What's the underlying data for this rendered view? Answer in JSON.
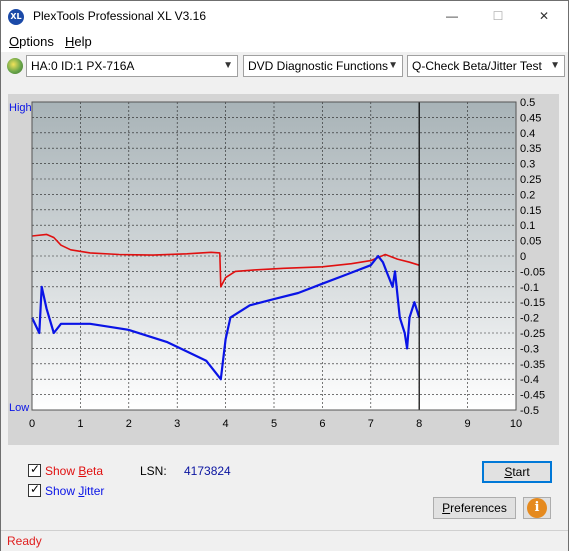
{
  "window": {
    "title": "PlexTools Professional XL V3.16",
    "app_icon_text": "XL",
    "minimize_glyph": "—",
    "maximize_glyph": "☐",
    "close_glyph": "✕"
  },
  "menu": [
    {
      "label_u": "O",
      "label_rest": "ptions"
    },
    {
      "label_u": "H",
      "label_rest": "elp"
    }
  ],
  "toolbar": {
    "drive": "HA:0 ID:1  PX-716A",
    "function": "DVD Diagnostic Functions",
    "test": "Q-Check Beta/Jitter Test",
    "dropdown_glyph": "▼"
  },
  "chart_data": {
    "type": "line",
    "x_ticks": [
      "0",
      "1",
      "2",
      "3",
      "4",
      "5",
      "6",
      "7",
      "8",
      "9",
      "10"
    ],
    "y_left_labels": {
      "top": "High",
      "bottom": "Low"
    },
    "y_right_ticks": [
      "0.5",
      "0.45",
      "0.4",
      "0.35",
      "0.3",
      "0.25",
      "0.2",
      "0.15",
      "0.1",
      "0.05",
      "0",
      "-0.05",
      "-0.1",
      "-0.15",
      "-0.2",
      "-0.25",
      "-0.3",
      "-0.35",
      "-0.4",
      "-0.45",
      "-0.5"
    ],
    "xlim": [
      0,
      10
    ],
    "ylim": [
      -0.5,
      0.5
    ],
    "grid": true,
    "end_marker_x": 8.0,
    "series": [
      {
        "color": "#e01010",
        "points": [
          [
            0,
            0.065
          ],
          [
            0.3,
            0.07
          ],
          [
            0.45,
            0.06
          ],
          [
            0.6,
            0.035
          ],
          [
            0.8,
            0.02
          ],
          [
            1.2,
            0.01
          ],
          [
            1.8,
            0.005
          ],
          [
            2.5,
            0.003
          ],
          [
            3.2,
            0.007
          ],
          [
            3.7,
            0.012
          ],
          [
            3.88,
            0.01
          ],
          [
            3.9,
            -0.1
          ],
          [
            4.0,
            -0.07
          ],
          [
            4.2,
            -0.05
          ],
          [
            4.6,
            -0.045
          ],
          [
            5.2,
            -0.04
          ],
          [
            6.0,
            -0.035
          ],
          [
            6.6,
            -0.025
          ],
          [
            7.0,
            -0.015
          ],
          [
            7.3,
            0.005
          ],
          [
            7.55,
            -0.01
          ],
          [
            7.8,
            -0.02
          ],
          [
            8.0,
            -0.03
          ]
        ]
      },
      {
        "color": "#0a14e6",
        "points": [
          [
            0,
            -0.2
          ],
          [
            0.15,
            -0.25
          ],
          [
            0.2,
            -0.1
          ],
          [
            0.3,
            -0.17
          ],
          [
            0.45,
            -0.25
          ],
          [
            0.6,
            -0.22
          ],
          [
            0.8,
            -0.22
          ],
          [
            1.2,
            -0.22
          ],
          [
            1.6,
            -0.23
          ],
          [
            2.0,
            -0.24
          ],
          [
            2.4,
            -0.26
          ],
          [
            2.8,
            -0.28
          ],
          [
            3.2,
            -0.31
          ],
          [
            3.6,
            -0.34
          ],
          [
            3.9,
            -0.4
          ],
          [
            4.0,
            -0.27
          ],
          [
            4.1,
            -0.2
          ],
          [
            4.5,
            -0.16
          ],
          [
            5.0,
            -0.14
          ],
          [
            5.5,
            -0.12
          ],
          [
            6.0,
            -0.09
          ],
          [
            6.5,
            -0.06
          ],
          [
            7.0,
            -0.03
          ],
          [
            7.15,
            0.0
          ],
          [
            7.25,
            -0.02
          ],
          [
            7.35,
            -0.06
          ],
          [
            7.45,
            -0.1
          ],
          [
            7.5,
            -0.05
          ],
          [
            7.6,
            -0.2
          ],
          [
            7.7,
            -0.25
          ],
          [
            7.75,
            -0.3
          ],
          [
            7.8,
            -0.2
          ],
          [
            7.9,
            -0.15
          ],
          [
            8.0,
            -0.2
          ]
        ]
      }
    ]
  },
  "bottom": {
    "show_beta_u": "B",
    "show_beta_pre": "Show ",
    "show_beta_post": "eta",
    "show_jitter_u": "J",
    "show_jitter_pre": "Show ",
    "show_jitter_post": "itter",
    "lsn_label": "LSN:",
    "lsn_value": "4173824",
    "start_u": "S",
    "start_rest": "tart",
    "prefs_u": "P",
    "prefs_rest": "references",
    "info_glyph": "i",
    "check_glyph": "✓",
    "beta_color": "#e01010",
    "jitter_color": "#0a14e6",
    "lsn_color": "#0a14a0"
  },
  "status": {
    "text": "Ready"
  }
}
